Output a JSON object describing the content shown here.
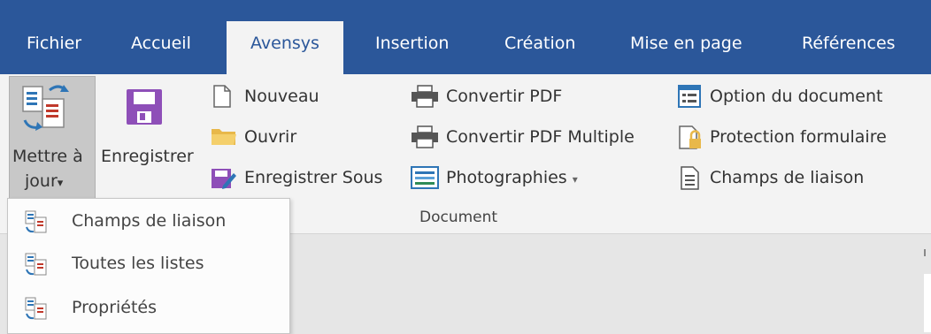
{
  "tabs": [
    {
      "label": "Fichier"
    },
    {
      "label": "Accueil"
    },
    {
      "label": "Avensys"
    },
    {
      "label": "Insertion"
    },
    {
      "label": "Création"
    },
    {
      "label": "Mise en page"
    },
    {
      "label": "Références"
    }
  ],
  "active_tab": "Avensys",
  "ribbon": {
    "update": {
      "label_line1": "Mettre à",
      "label_line2": "jour",
      "arrow": "▾"
    },
    "save": {
      "label": "Enregistrer"
    },
    "file_col": {
      "new": "Nouveau",
      "open": "Ouvrir",
      "save_as": "Enregistrer Sous"
    },
    "pdf_col": {
      "convert_pdf": "Convertir PDF",
      "convert_pdf_multi": "Convertir PDF Multiple",
      "photos": "Photographies",
      "photos_arrow": "▾"
    },
    "options_col": {
      "doc_option": "Option du document",
      "form_protection": "Protection formulaire",
      "link_fields": "Champs de liaison"
    },
    "group_label": "Document"
  },
  "dropdown": {
    "items": [
      {
        "label": "Champs de liaison"
      },
      {
        "label": "Toutes les listes"
      },
      {
        "label": "Propriétés"
      }
    ]
  },
  "colors": {
    "tab_bar": "#2b579a",
    "ribbon_bg": "#f3f3f3",
    "save_purple": "#8e4fb8",
    "folder_yellow": "#e8b84a"
  },
  "icons": {
    "update": "update-doc-icon",
    "save": "floppy-disk-icon",
    "new": "blank-page-icon",
    "open": "folder-icon",
    "save_as": "save-as-icon",
    "printer": "printer-icon",
    "photos": "picture-icon",
    "doc_option": "options-list-icon",
    "form_protection": "lock-page-icon",
    "link_fields": "page-lines-icon"
  }
}
